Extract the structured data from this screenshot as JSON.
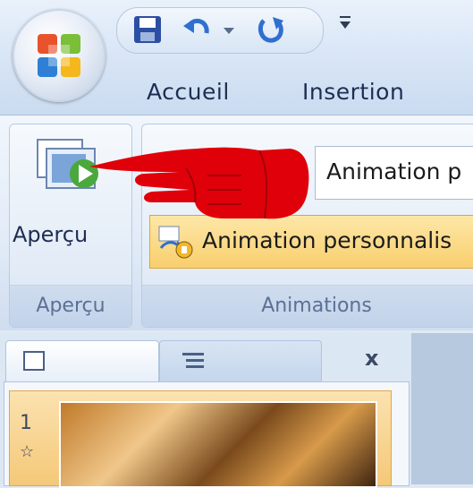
{
  "quick_access": {
    "save_icon": "save-icon",
    "undo_icon": "undo-icon",
    "undo_dropdown_icon": "chevron-down-icon",
    "redo_icon": "redo-icon",
    "customize_icon": "customize-qat-icon"
  },
  "tabs": [
    {
      "label": "Accueil"
    },
    {
      "label": "Insertion"
    }
  ],
  "ribbon": {
    "apercu_group": {
      "button_label": "Aperçu",
      "group_label": "Aperçu"
    },
    "animations_group": {
      "dropdown_value": "Animation p",
      "custom_button_label": "Animation personnalis",
      "group_label": "Animations"
    }
  },
  "slides_pane": {
    "close_label": "x",
    "slide_number": "1",
    "star_glyph": "☆"
  },
  "colors": {
    "pointer_hand": "#e0000a",
    "custom_button_fill": "#f9cf6e"
  }
}
